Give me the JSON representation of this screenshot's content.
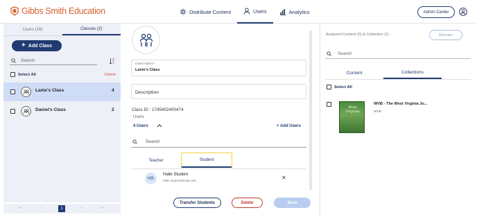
{
  "header": {
    "logo_text": "Gibbs Smith Education",
    "nav": [
      {
        "label": "Distribute Content",
        "icon": "distribute-icon"
      },
      {
        "label": "Users",
        "icon": "user-icon",
        "active": true
      },
      {
        "label": "Analytics",
        "icon": "analytics-icon"
      }
    ],
    "admin_center_label": "Admin Center"
  },
  "left_panel": {
    "tabs": [
      {
        "label": "Users (16)"
      },
      {
        "label": "Classes (2)",
        "active": true
      }
    ],
    "add_class_label": "Add Class",
    "search_placeholder": "Search",
    "select_all_label": "Select All",
    "delete_label": "Delete",
    "classes": [
      {
        "name": "Lanie's Class",
        "count": "4",
        "selected": true
      },
      {
        "name": "Daniel's Class",
        "count": "2",
        "selected": false
      }
    ],
    "pagination": {
      "first": "«",
      "prev": "‹",
      "current": "1",
      "next": "›",
      "last": "»"
    }
  },
  "middle_panel": {
    "class_name_label": "Class Name *",
    "class_name_value": "Lanie's Class",
    "description_placeholder": "Description",
    "class_id": "Class ID : 1745402400474",
    "users_label": "Users",
    "users_count": "4 Users",
    "add_users_label": "+ Add Users",
    "search_placeholder": "Search",
    "tabs": [
      {
        "label": "Teacher"
      },
      {
        "label": "Student",
        "active": true
      }
    ],
    "user": {
      "initials": "HS",
      "name": "Halle Student",
      "email": "halle.student@mail.com"
    },
    "buttons": {
      "transfer": "Transfer Students",
      "delete": "Delete",
      "save": "Save"
    }
  },
  "right_panel": {
    "assigned_label": "Assigned Content (0) & Collection (1)",
    "revoke_label": "Revoke",
    "search_placeholder": "Search",
    "tabs": [
      {
        "label": "Content"
      },
      {
        "label": "Collections",
        "active": true
      }
    ],
    "select_all_label": "Select All",
    "item": {
      "title": "WVB - The West Virginia Jo...",
      "subtitle": "WVB",
      "cover_text": "West Virginia"
    }
  },
  "colors": {
    "brand_orange": "#d8602b",
    "navy": "#1f3b72",
    "selected_row": "#cfdcf6",
    "highlight": "#f0d13b"
  }
}
